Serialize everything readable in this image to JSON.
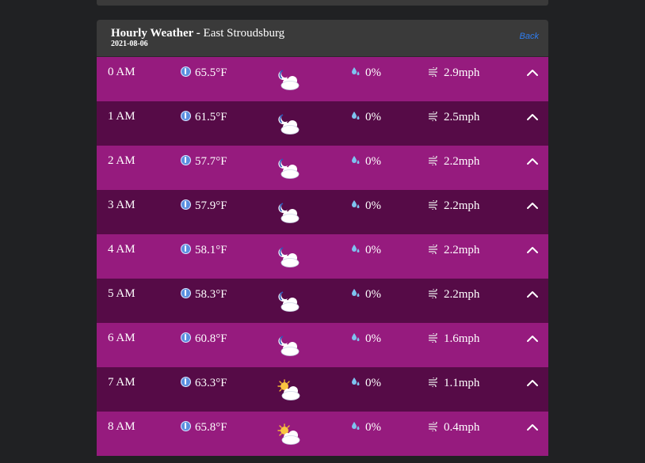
{
  "header": {
    "title": "Hourly Weather",
    "separator": " - ",
    "location": "East Stroudsburg",
    "date": "2021-08-06",
    "back_label": "Back"
  },
  "rows": [
    {
      "hour": "0 AM",
      "temp": "65.5°F",
      "condition": "clear-night-cloud",
      "precip": "0%",
      "wind": "2.9mph"
    },
    {
      "hour": "1 AM",
      "temp": "61.5°F",
      "condition": "clear-night-cloud",
      "precip": "0%",
      "wind": "2.5mph"
    },
    {
      "hour": "2 AM",
      "temp": "57.7°F",
      "condition": "clear-night-cloud",
      "precip": "0%",
      "wind": "2.2mph"
    },
    {
      "hour": "3 AM",
      "temp": "57.9°F",
      "condition": "clear-night-cloud",
      "precip": "0%",
      "wind": "2.2mph"
    },
    {
      "hour": "4 AM",
      "temp": "58.1°F",
      "condition": "clear-night-cloud",
      "precip": "0%",
      "wind": "2.2mph"
    },
    {
      "hour": "5 AM",
      "temp": "58.3°F",
      "condition": "clear-night-cloud",
      "precip": "0%",
      "wind": "2.2mph"
    },
    {
      "hour": "6 AM",
      "temp": "60.8°F",
      "condition": "clear-night-cloud",
      "precip": "0%",
      "wind": "1.6mph"
    },
    {
      "hour": "7 AM",
      "temp": "63.3°F",
      "condition": "sun-cloud",
      "precip": "0%",
      "wind": "1.1mph"
    },
    {
      "hour": "8 AM",
      "temp": "65.8°F",
      "condition": "sun-cloud",
      "precip": "0%",
      "wind": "0.4mph"
    }
  ],
  "colors": {
    "row_light": "#961b7e",
    "row_dark": "#560b47",
    "header_bg": "#3a3a3a",
    "link": "#2f7df0"
  },
  "icons": {
    "temp": "thermometer-icon",
    "precip": "raindrop-icon",
    "wind": "wind-icon",
    "toggle": "chevron-up-icon"
  }
}
